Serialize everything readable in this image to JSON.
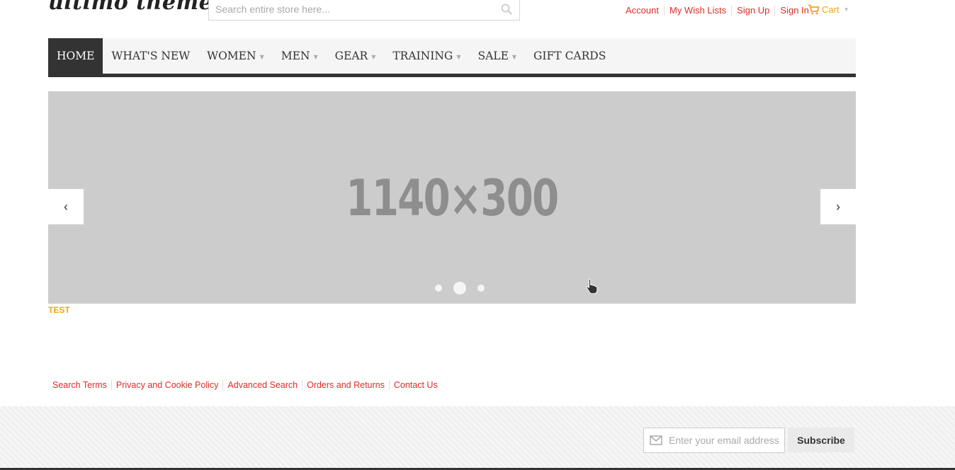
{
  "header": {
    "logo_text": "ultimo theme",
    "search_placeholder": "Search entire store here...",
    "links": [
      "Account",
      "My Wish Lists",
      "Sign Up",
      "Sign In"
    ],
    "cart_label": "Cart",
    "accent_color": "#e02b27",
    "cart_color": "#f2a515"
  },
  "nav": {
    "items": [
      {
        "label": "HOME",
        "active": true,
        "dropdown": false
      },
      {
        "label": "WHAT'S NEW",
        "active": false,
        "dropdown": false
      },
      {
        "label": "WOMEN",
        "active": false,
        "dropdown": true
      },
      {
        "label": "MEN",
        "active": false,
        "dropdown": true
      },
      {
        "label": "GEAR",
        "active": false,
        "dropdown": true
      },
      {
        "label": "TRAINING",
        "active": false,
        "dropdown": true
      },
      {
        "label": "SALE",
        "active": false,
        "dropdown": true
      },
      {
        "label": "GIFT CARDS",
        "active": false,
        "dropdown": false
      }
    ]
  },
  "slider": {
    "placeholder_text": "1140×300",
    "prev_icon": "chevron-left-icon",
    "next_icon": "chevron-right-icon",
    "slide_count": 3,
    "active_slide": 2
  },
  "content": {
    "test_label": "TEST"
  },
  "footer": {
    "links": [
      "Search Terms",
      "Privacy and Cookie Policy",
      "Advanced Search",
      "Orders and Returns",
      "Contact Us"
    ],
    "newsletter_placeholder": "Enter your email address",
    "subscribe_label": "Subscribe"
  }
}
